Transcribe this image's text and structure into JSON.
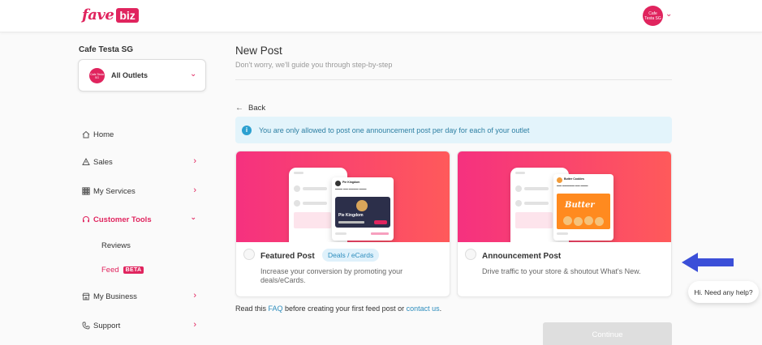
{
  "app": {
    "logo_fave": "fave",
    "logo_biz": "biz",
    "brand_color": "#e0245e"
  },
  "header": {
    "user_avatar_text": "Cafe Testa SG"
  },
  "sidebar": {
    "merchant_name": "Cafe Testa SG",
    "outlet_avatar_text": "Cafe Testa SG",
    "outlet_label": "All Outlets",
    "nav": [
      {
        "label": "Home",
        "icon": "home-icon"
      },
      {
        "label": "Sales",
        "icon": "sales-icon"
      },
      {
        "label": "My Services",
        "icon": "grid-icon"
      },
      {
        "label": "Customer Tools",
        "icon": "headset-icon"
      },
      {
        "label": "My Business",
        "icon": "store-icon"
      },
      {
        "label": "Support",
        "icon": "phone-icon"
      }
    ],
    "sub": {
      "reviews": "Reviews",
      "feed": "Feed",
      "beta": "BETA"
    }
  },
  "main": {
    "title": "New Post",
    "subtitle": "Don't worry, we'll guide you through step-by-step",
    "back_label": "Back",
    "info_banner": "You are only allowed to post one announcement post per day for each of your outlet",
    "cards": [
      {
        "title": "Featured Post",
        "tag": "Deals / eCards",
        "description": "Increase your conversion by promoting your deals/eCards.",
        "preview_name": "Pie Kingdom",
        "preview_banner": "Pie Kingdom"
      },
      {
        "title": "Announcement Post",
        "description": "Drive traffic to your store & shoutout What's New.",
        "preview_name": "Butter Cookies",
        "preview_banner": "Butter"
      }
    ],
    "footer": {
      "prefix": "Read this ",
      "faq": "FAQ",
      "middle": " before creating your first feed post or ",
      "contact": "contact us",
      "suffix": "."
    },
    "continue_label": "Continue"
  },
  "help": {
    "label": "Hi. Need any help?"
  }
}
